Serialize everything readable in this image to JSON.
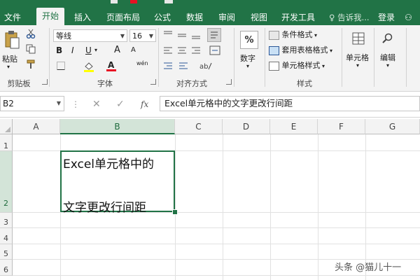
{
  "tabs": [
    {
      "label": "文件",
      "active": false
    },
    {
      "label": "开始",
      "active": true
    },
    {
      "label": "插入",
      "active": false
    },
    {
      "label": "页面布局",
      "active": false
    },
    {
      "label": "公式",
      "active": false
    },
    {
      "label": "数据",
      "active": false
    },
    {
      "label": "审阅",
      "active": false
    },
    {
      "label": "视图",
      "active": false
    },
    {
      "label": "开发工具",
      "active": false
    }
  ],
  "tell_me": "告诉我...",
  "login": "登录",
  "share": "共",
  "ribbon": {
    "clipboard": {
      "paste": "粘贴",
      "label": "剪贴板"
    },
    "font": {
      "name": "等线",
      "size": "16",
      "label": "字体",
      "bold": "B",
      "italic": "I",
      "underline": "U",
      "grow": "A",
      "shrink": "A",
      "phonetic": "wén"
    },
    "alignment": {
      "label": "对齐方式"
    },
    "number": {
      "label": "数字",
      "symbol": "%"
    },
    "styles": {
      "conditional": "条件格式",
      "table": "套用表格格式",
      "cell_styles": "单元格样式",
      "label": "样式"
    },
    "cells": {
      "label": "单元格"
    },
    "editing": {
      "label": "编辑"
    }
  },
  "formula_bar": {
    "name_box": "B2",
    "fx": "fx",
    "content": "Excel单元格中的文字更改行间距"
  },
  "columns": [
    "A",
    "B",
    "C",
    "D",
    "E",
    "F",
    "G"
  ],
  "rows": [
    "1",
    "2",
    "3",
    "4",
    "5",
    "6"
  ],
  "selected_column": "B",
  "selected_row": "2",
  "cell_b2": {
    "line1": "Excel单元格中的",
    "line2": "文字更改行间距"
  },
  "watermark": "头条 @猫儿十一",
  "colors": {
    "accent": "#217346",
    "ribbon_bg": "#f3f3f3",
    "selected_header": "#d3e4d8"
  }
}
